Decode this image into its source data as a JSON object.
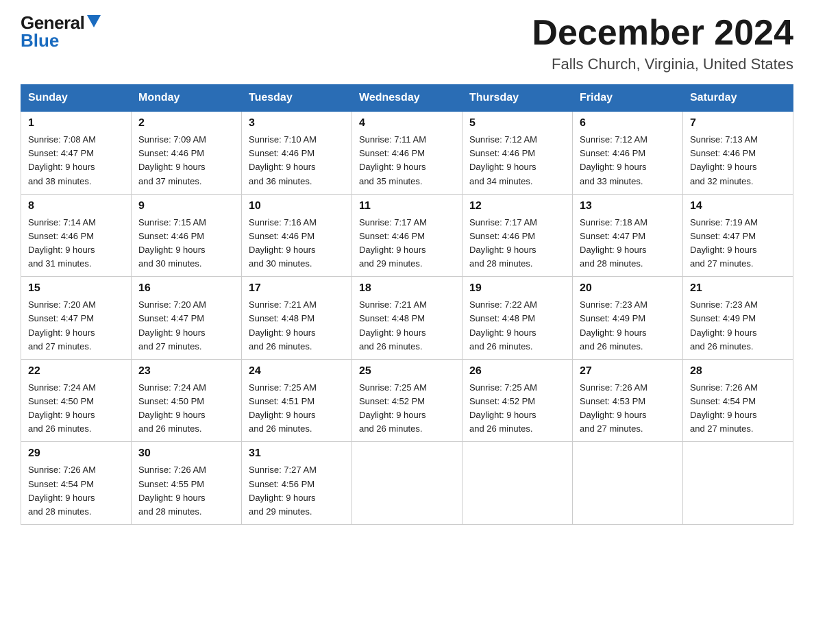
{
  "logo": {
    "general": "General",
    "blue": "Blue"
  },
  "header": {
    "month": "December 2024",
    "location": "Falls Church, Virginia, United States"
  },
  "weekdays": [
    "Sunday",
    "Monday",
    "Tuesday",
    "Wednesday",
    "Thursday",
    "Friday",
    "Saturday"
  ],
  "weeks": [
    [
      {
        "day": "1",
        "sunrise": "7:08 AM",
        "sunset": "4:47 PM",
        "daylight": "9 hours and 38 minutes."
      },
      {
        "day": "2",
        "sunrise": "7:09 AM",
        "sunset": "4:46 PM",
        "daylight": "9 hours and 37 minutes."
      },
      {
        "day": "3",
        "sunrise": "7:10 AM",
        "sunset": "4:46 PM",
        "daylight": "9 hours and 36 minutes."
      },
      {
        "day": "4",
        "sunrise": "7:11 AM",
        "sunset": "4:46 PM",
        "daylight": "9 hours and 35 minutes."
      },
      {
        "day": "5",
        "sunrise": "7:12 AM",
        "sunset": "4:46 PM",
        "daylight": "9 hours and 34 minutes."
      },
      {
        "day": "6",
        "sunrise": "7:12 AM",
        "sunset": "4:46 PM",
        "daylight": "9 hours and 33 minutes."
      },
      {
        "day": "7",
        "sunrise": "7:13 AM",
        "sunset": "4:46 PM",
        "daylight": "9 hours and 32 minutes."
      }
    ],
    [
      {
        "day": "8",
        "sunrise": "7:14 AM",
        "sunset": "4:46 PM",
        "daylight": "9 hours and 31 minutes."
      },
      {
        "day": "9",
        "sunrise": "7:15 AM",
        "sunset": "4:46 PM",
        "daylight": "9 hours and 30 minutes."
      },
      {
        "day": "10",
        "sunrise": "7:16 AM",
        "sunset": "4:46 PM",
        "daylight": "9 hours and 30 minutes."
      },
      {
        "day": "11",
        "sunrise": "7:17 AM",
        "sunset": "4:46 PM",
        "daylight": "9 hours and 29 minutes."
      },
      {
        "day": "12",
        "sunrise": "7:17 AM",
        "sunset": "4:46 PM",
        "daylight": "9 hours and 28 minutes."
      },
      {
        "day": "13",
        "sunrise": "7:18 AM",
        "sunset": "4:47 PM",
        "daylight": "9 hours and 28 minutes."
      },
      {
        "day": "14",
        "sunrise": "7:19 AM",
        "sunset": "4:47 PM",
        "daylight": "9 hours and 27 minutes."
      }
    ],
    [
      {
        "day": "15",
        "sunrise": "7:20 AM",
        "sunset": "4:47 PM",
        "daylight": "9 hours and 27 minutes."
      },
      {
        "day": "16",
        "sunrise": "7:20 AM",
        "sunset": "4:47 PM",
        "daylight": "9 hours and 27 minutes."
      },
      {
        "day": "17",
        "sunrise": "7:21 AM",
        "sunset": "4:48 PM",
        "daylight": "9 hours and 26 minutes."
      },
      {
        "day": "18",
        "sunrise": "7:21 AM",
        "sunset": "4:48 PM",
        "daylight": "9 hours and 26 minutes."
      },
      {
        "day": "19",
        "sunrise": "7:22 AM",
        "sunset": "4:48 PM",
        "daylight": "9 hours and 26 minutes."
      },
      {
        "day": "20",
        "sunrise": "7:23 AM",
        "sunset": "4:49 PM",
        "daylight": "9 hours and 26 minutes."
      },
      {
        "day": "21",
        "sunrise": "7:23 AM",
        "sunset": "4:49 PM",
        "daylight": "9 hours and 26 minutes."
      }
    ],
    [
      {
        "day": "22",
        "sunrise": "7:24 AM",
        "sunset": "4:50 PM",
        "daylight": "9 hours and 26 minutes."
      },
      {
        "day": "23",
        "sunrise": "7:24 AM",
        "sunset": "4:50 PM",
        "daylight": "9 hours and 26 minutes."
      },
      {
        "day": "24",
        "sunrise": "7:25 AM",
        "sunset": "4:51 PM",
        "daylight": "9 hours and 26 minutes."
      },
      {
        "day": "25",
        "sunrise": "7:25 AM",
        "sunset": "4:52 PM",
        "daylight": "9 hours and 26 minutes."
      },
      {
        "day": "26",
        "sunrise": "7:25 AM",
        "sunset": "4:52 PM",
        "daylight": "9 hours and 26 minutes."
      },
      {
        "day": "27",
        "sunrise": "7:26 AM",
        "sunset": "4:53 PM",
        "daylight": "9 hours and 27 minutes."
      },
      {
        "day": "28",
        "sunrise": "7:26 AM",
        "sunset": "4:54 PM",
        "daylight": "9 hours and 27 minutes."
      }
    ],
    [
      {
        "day": "29",
        "sunrise": "7:26 AM",
        "sunset": "4:54 PM",
        "daylight": "9 hours and 28 minutes."
      },
      {
        "day": "30",
        "sunrise": "7:26 AM",
        "sunset": "4:55 PM",
        "daylight": "9 hours and 28 minutes."
      },
      {
        "day": "31",
        "sunrise": "7:27 AM",
        "sunset": "4:56 PM",
        "daylight": "9 hours and 29 minutes."
      },
      null,
      null,
      null,
      null
    ]
  ],
  "labels": {
    "sunrise": "Sunrise:",
    "sunset": "Sunset:",
    "daylight": "Daylight:"
  }
}
